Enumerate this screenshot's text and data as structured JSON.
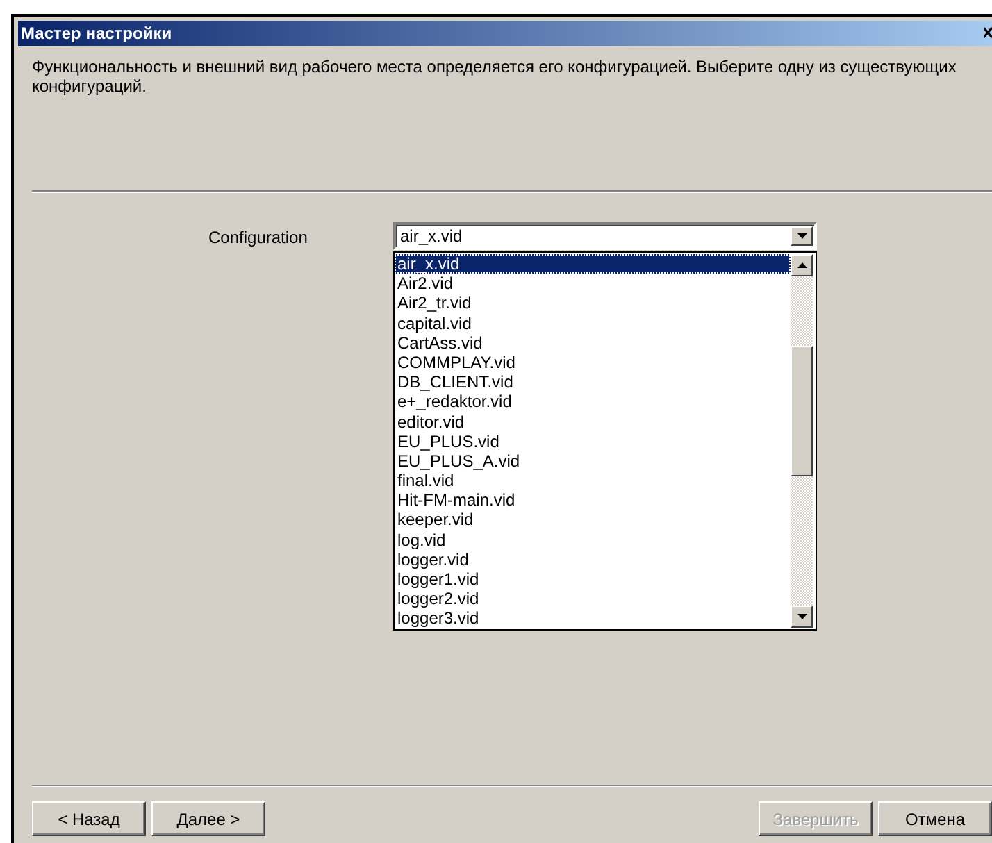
{
  "window": {
    "title": "Мастер настройки"
  },
  "description": "Функциональность и внешний вид рабочего места определяется его конфигурацией. Выберите одну из существующих конфигураций.",
  "configuration": {
    "label": "Configuration",
    "value": "air_x.vid",
    "expanded": true,
    "options": [
      {
        "text": "air_x.vid",
        "selected": true
      },
      {
        "text": "Air2.vid",
        "selected": false
      },
      {
        "text": "Air2_tr.vid",
        "selected": false
      },
      {
        "text": "capital.vid",
        "selected": false
      },
      {
        "text": "CartAss.vid",
        "selected": false
      },
      {
        "text": "COMMPLAY.vid",
        "selected": false
      },
      {
        "text": "DB_CLIENT.vid",
        "selected": false
      },
      {
        "text": "e+_redaktor.vid",
        "selected": false
      },
      {
        "text": "editor.vid",
        "selected": false
      },
      {
        "text": "EU_PLUS.vid",
        "selected": false
      },
      {
        "text": "EU_PLUS_A.vid",
        "selected": false
      },
      {
        "text": "final.vid",
        "selected": false
      },
      {
        "text": "Hit-FM-main.vid",
        "selected": false
      },
      {
        "text": "keeper.vid",
        "selected": false
      },
      {
        "text": "log.vid",
        "selected": false
      },
      {
        "text": "logger.vid",
        "selected": false
      },
      {
        "text": "logger1.vid",
        "selected": false
      },
      {
        "text": "logger2.vid",
        "selected": false
      },
      {
        "text": "logger3.vid",
        "selected": false
      }
    ]
  },
  "nav_buttons": [
    {
      "label": "< Назад",
      "disabled": false
    },
    {
      "label": "Далее >",
      "disabled": false
    }
  ],
  "action_buttons": [
    {
      "label": "Завершить",
      "disabled": true
    },
    {
      "label": "Отмена",
      "disabled": false
    }
  ]
}
